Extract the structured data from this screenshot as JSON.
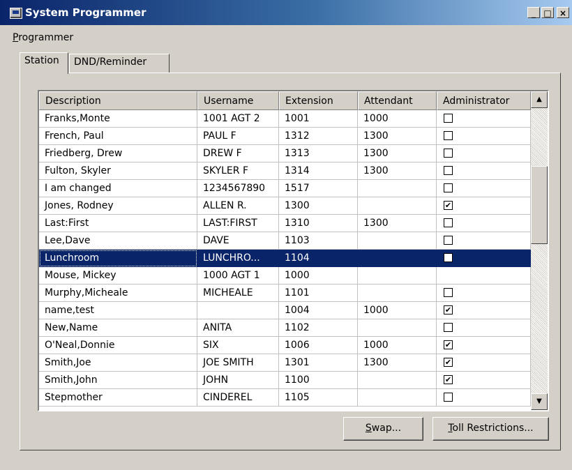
{
  "window": {
    "title": "System Programmer",
    "minimize": "_",
    "maximize": "□",
    "close": "×"
  },
  "menu": {
    "programmer_mnemonic": "P",
    "programmer_rest": "rogrammer"
  },
  "tabs": [
    {
      "label": "Station",
      "active": true
    },
    {
      "label": "DND/Reminder",
      "active": false
    }
  ],
  "table": {
    "columns": [
      "Description",
      "Username",
      "Extension",
      "Attendant",
      "Administrator"
    ],
    "rows": [
      {
        "description": "Franks,Monte",
        "username": "1001 AGT 2",
        "extension": "1001",
        "attendant": "1000",
        "admin": false
      },
      {
        "description": "French, Paul",
        "username": "PAUL F",
        "extension": "1312",
        "attendant": "1300",
        "admin": false
      },
      {
        "description": "Friedberg, Drew",
        "username": "DREW F",
        "extension": "1313",
        "attendant": "1300",
        "admin": false
      },
      {
        "description": "Fulton, Skyler",
        "username": "SKYLER F",
        "extension": "1314",
        "attendant": "1300",
        "admin": false
      },
      {
        "description": "I am changed",
        "username": "1234567890",
        "extension": "1517",
        "attendant": "",
        "admin": false
      },
      {
        "description": "Jones, Rodney",
        "username": "ALLEN R.",
        "extension": "1300",
        "attendant": "",
        "admin": true
      },
      {
        "description": "Last:First",
        "username": "LAST:FIRST",
        "extension": "1310",
        "attendant": "1300",
        "admin": false
      },
      {
        "description": "Lee,Dave",
        "username": "DAVE",
        "extension": "1103",
        "attendant": "",
        "admin": false
      },
      {
        "description": "Lunchroom",
        "username": "LUNCHRO...",
        "extension": "1104",
        "attendant": "",
        "admin": false,
        "selected": true
      },
      {
        "description": "Mouse, Mickey",
        "username": "1000 AGT 1",
        "extension": "1000",
        "attendant": "",
        "admin": null
      },
      {
        "description": "Murphy,Micheale",
        "username": "MICHEALE",
        "extension": "1101",
        "attendant": "",
        "admin": false
      },
      {
        "description": "name,test",
        "username": "",
        "extension": "1004",
        "attendant": "1000",
        "admin": true
      },
      {
        "description": "New,Name",
        "username": "ANITA",
        "extension": "1102",
        "attendant": "",
        "admin": false
      },
      {
        "description": "O'Neal,Donnie",
        "username": "SIX",
        "extension": "1006",
        "attendant": "1000",
        "admin": true
      },
      {
        "description": "Smith,Joe",
        "username": "JOE SMITH",
        "extension": "1301",
        "attendant": "1300",
        "admin": true
      },
      {
        "description": "Smith,John",
        "username": "JOHN",
        "extension": "1100",
        "attendant": "",
        "admin": true
      },
      {
        "description": "Stepmother",
        "username": "CINDEREL",
        "extension": "1105",
        "attendant": "",
        "admin": false
      }
    ]
  },
  "scroll": {
    "up_arrow": "▲",
    "down_arrow": "▼"
  },
  "buttons": {
    "swap_mnemonic": "S",
    "swap_rest": "wap...",
    "toll_mnemonic": "T",
    "toll_rest": "oll Restrictions..."
  },
  "colors": {
    "selection": "#0a246a",
    "face": "#d4d0c8",
    "title_gradient_start": "#0a246a"
  }
}
